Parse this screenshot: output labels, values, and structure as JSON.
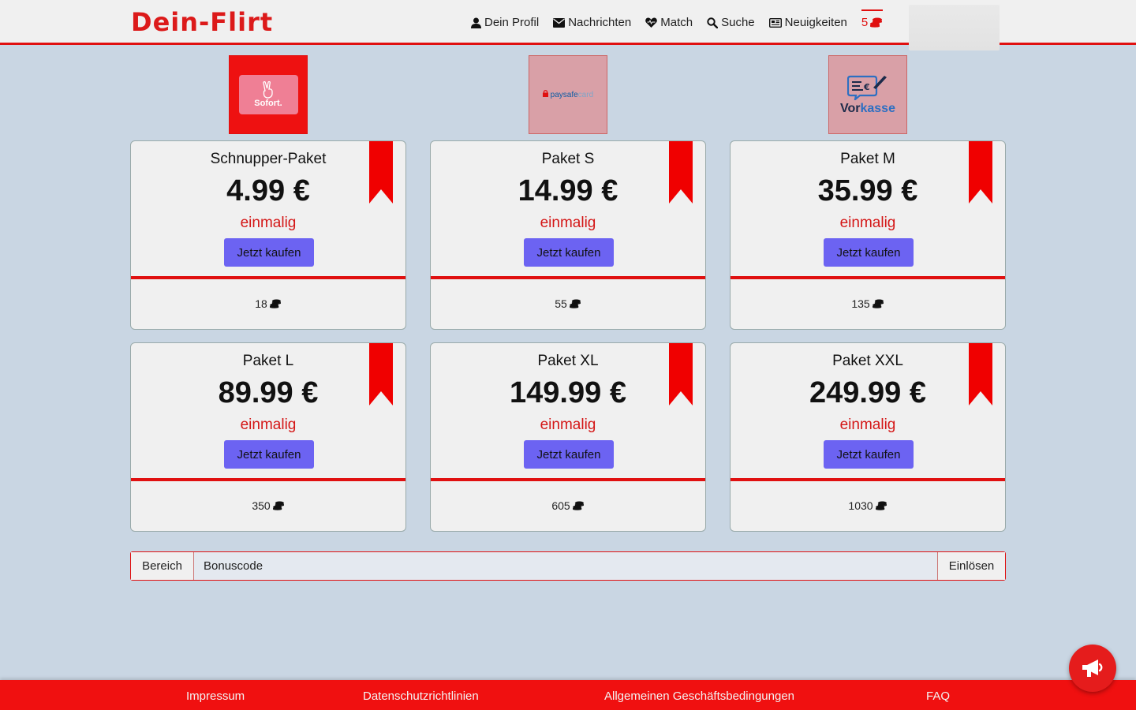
{
  "header": {
    "logo": "Dein-Flirt",
    "nav": [
      {
        "label": "Dein Profil",
        "icon": "user-icon"
      },
      {
        "label": "Nachrichten",
        "icon": "envelope-icon"
      },
      {
        "label": "Match",
        "icon": "heart-icon"
      },
      {
        "label": "Suche",
        "icon": "search-icon"
      },
      {
        "label": "Neuigkeiten",
        "icon": "newspaper-icon"
      }
    ],
    "coins": "5",
    "coins_icon": "coins-icon"
  },
  "payment_methods": [
    {
      "name": "sofort",
      "label": "Sofort."
    },
    {
      "name": "paysafecard",
      "label": "paysafe",
      "label_suffix": "card"
    },
    {
      "name": "vorkasse",
      "label": "Vor",
      "label_suffix": "kasse"
    }
  ],
  "packages": [
    {
      "name": "Schnupper-Paket",
      "price": "4.99 €",
      "period": "einmalig",
      "button": "Jetzt kaufen",
      "coins": "18"
    },
    {
      "name": "Paket S",
      "price": "14.99 €",
      "period": "einmalig",
      "button": "Jetzt kaufen",
      "coins": "55"
    },
    {
      "name": "Paket M",
      "price": "35.99 €",
      "period": "einmalig",
      "button": "Jetzt kaufen",
      "coins": "135"
    },
    {
      "name": "Paket L",
      "price": "89.99 €",
      "period": "einmalig",
      "button": "Jetzt kaufen",
      "coins": "350"
    },
    {
      "name": "Paket XL",
      "price": "149.99 €",
      "period": "einmalig",
      "button": "Jetzt kaufen",
      "coins": "605"
    },
    {
      "name": "Paket XXL",
      "price": "249.99 €",
      "period": "einmalig",
      "button": "Jetzt kaufen",
      "coins": "1030"
    }
  ],
  "bonus": {
    "label": "Bereich",
    "placeholder": "Bonuscode",
    "button": "Einlösen"
  },
  "footer": {
    "links": [
      "Impressum",
      "Datenschutzrichtlinien",
      "Allgemeinen Geschäftsbedingungen",
      "FAQ"
    ]
  },
  "colors": {
    "accent": "#e01010",
    "button": "#6c63f2",
    "background": "#c9d6e3"
  }
}
